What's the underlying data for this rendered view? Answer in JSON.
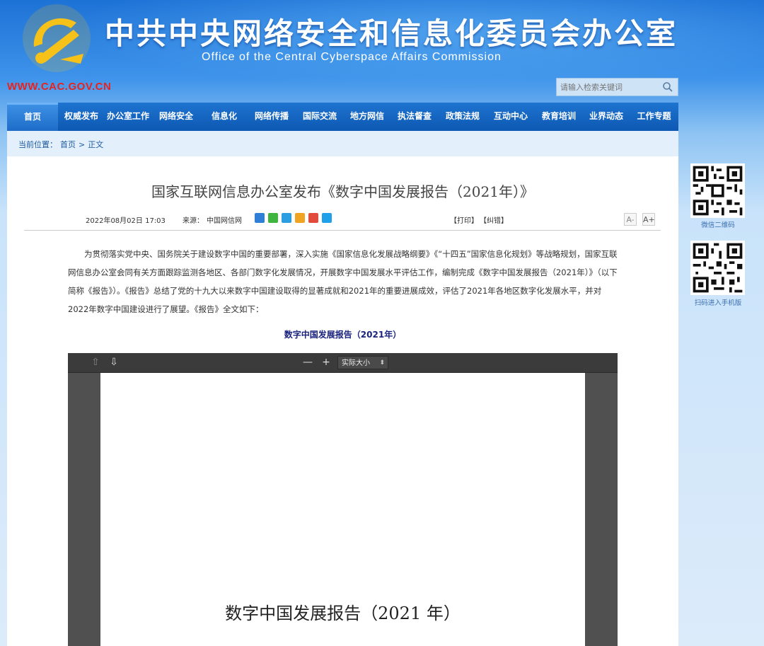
{
  "header": {
    "title": "中共中央网络安全和信息化委员会办公室",
    "subtitle": "Office of the Central Cyberspace Affairs Commission",
    "url": "WWW.CAC.GOV.CN",
    "search_placeholder": "请输入检索关键词",
    "emblem_icon": "party-emblem-icon",
    "search_icon": "search-icon"
  },
  "nav": {
    "items": [
      {
        "label": "首页"
      },
      {
        "label": "权威发布"
      },
      {
        "label": "办公室工作"
      },
      {
        "label": "网络安全"
      },
      {
        "label": "信息化"
      },
      {
        "label": "网络传播"
      },
      {
        "label": "国际交流"
      },
      {
        "label": "地方网信"
      },
      {
        "label": "执法督查"
      },
      {
        "label": "政策法规"
      },
      {
        "label": "互动中心"
      },
      {
        "label": "教育培训"
      },
      {
        "label": "业界动态"
      },
      {
        "label": "工作专题"
      }
    ],
    "active_index": 0
  },
  "breadcrumb": {
    "prefix": "当前位置：",
    "home": "首页",
    "sep": ">",
    "current": "正文"
  },
  "article": {
    "title": "国家互联网信息办公室发布《数字中国发展报告（2021年）》",
    "date": "2022年08月02日 17:03",
    "source_label": "来源：",
    "source": "中国网信网",
    "print": "【打印】",
    "error": "【纠错】",
    "font_decrease": "A-",
    "font_increase": "A+",
    "body": "为贯彻落实党中央、国务院关于建设数字中国的重要部署，深入实施《国家信息化发展战略纲要》《“十四五”国家信息化规划》等战略规划，国家互联网信息办公室会同有关方面跟踪监测各地区、各部门数字化发展情况，开展数字中国发展水平评估工作，编制完成《数字中国发展报告（2021年）》（以下简称《报告》）。《报告》总结了党的十九大以来数字中国建设取得的显著成就和2021年的重要进展成效，评估了2021年各地区数字化发展水平，并对2022年数字中国建设进行了展望。《报告》全文如下：",
    "subheading": "数字中国发展报告（2021年）"
  },
  "viewer": {
    "zoom_label": "实际大小",
    "minus": "—",
    "plus": "+",
    "page_title": "数字中国发展报告（2021 年）"
  },
  "sidebar": {
    "qr1_label": "微信二维码",
    "qr2_label": "扫码进入手机版"
  },
  "colors": {
    "brand_blue": "#0d58b2",
    "url_red": "#e8231f",
    "emblem_gold": "#f6c21a"
  }
}
